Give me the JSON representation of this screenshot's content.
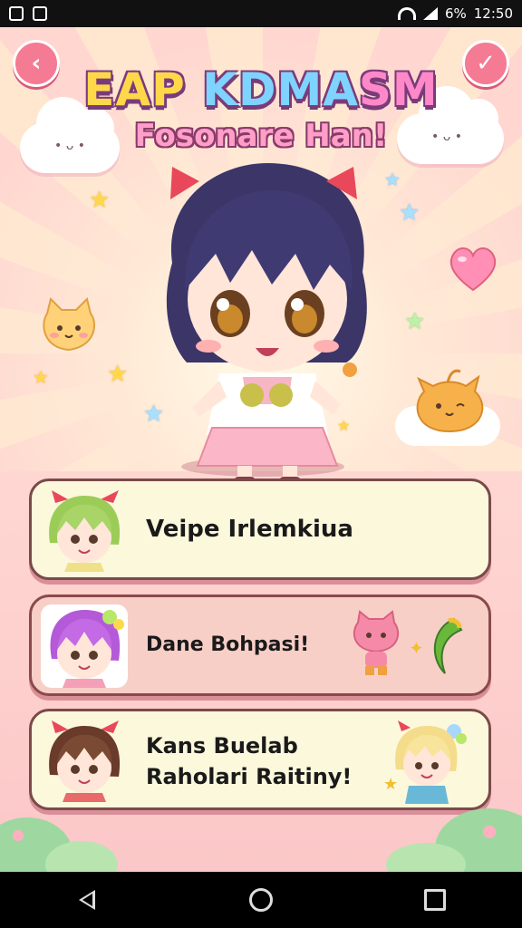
{
  "status": {
    "battery": "6%",
    "time": "12:50"
  },
  "header": {
    "title_part1": "EAP ",
    "title_part2": "KDMA",
    "title_part3": "SM",
    "subtitle": "Fosonare Han!"
  },
  "cards": [
    {
      "label": "Veipe Irlemkiua"
    },
    {
      "label": "Dane Bohpasi!"
    },
    {
      "line1": "Kans Buelab",
      "line2": "Raholari Raitiny!"
    }
  ],
  "icons": {
    "back": "chevron-left-icon",
    "confirm": "check-icon",
    "nav_back": "triangle-back-icon",
    "nav_home": "circle-home-icon",
    "nav_recent": "square-recent-icon"
  },
  "colors": {
    "accent_pink": "#f57a93",
    "card_cream": "#fbf8dc",
    "card_pink": "#f8cfc7"
  }
}
